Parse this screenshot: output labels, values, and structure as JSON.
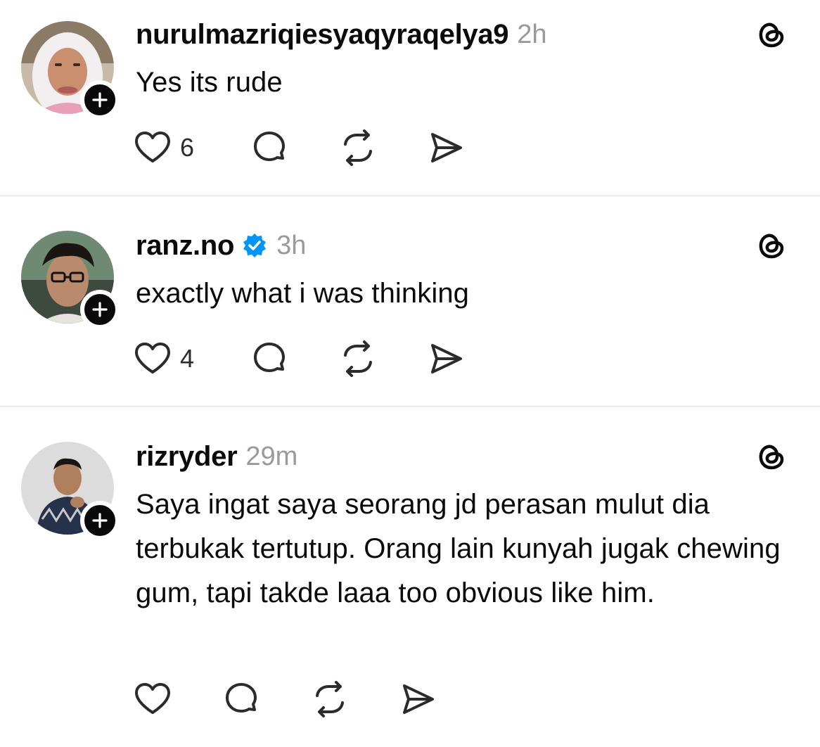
{
  "posts": [
    {
      "username": "nurulmazriqiesyaqyraqelya9",
      "verified": false,
      "time": "2h",
      "text": "Yes its rude",
      "likes": "6"
    },
    {
      "username": "ranz.no",
      "verified": true,
      "time": "3h",
      "text": "exactly what i was thinking",
      "likes": "4"
    },
    {
      "username": "rizryder",
      "verified": false,
      "time": "29m",
      "text": "Saya ingat saya seorang jd perasan mulut dia terbukak tertutup. Orang lain kunyah jugak chewing gum, tapi takde laaa too obvious like him.",
      "likes": ""
    }
  ],
  "colors": {
    "text": "#0a0a0a",
    "muted": "#9a9a9a",
    "verified_blue": "#0095f6",
    "divider": "#d9d9d9"
  }
}
